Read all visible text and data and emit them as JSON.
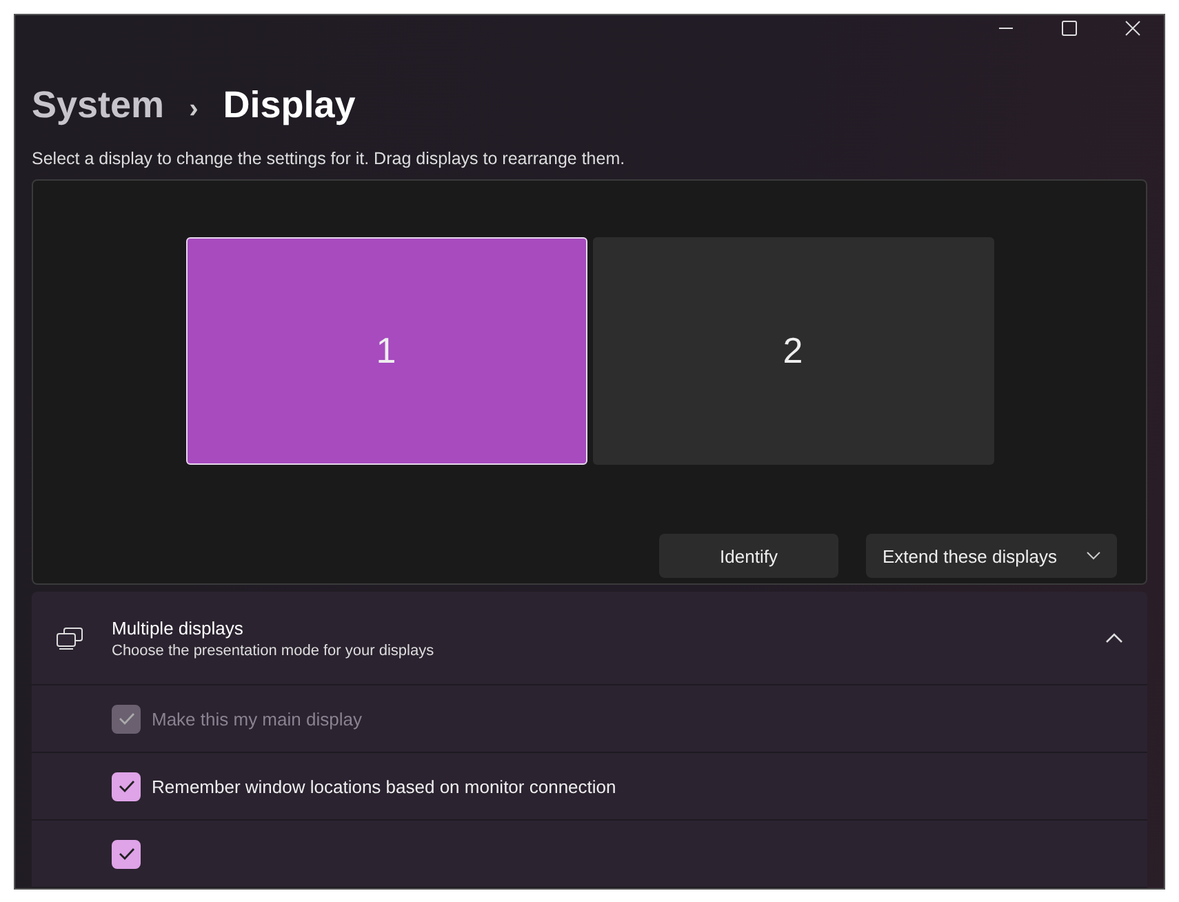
{
  "breadcrumb": {
    "parent": "System",
    "separator": "›",
    "current": "Display"
  },
  "description": "Select a display to change the settings for it. Drag displays to rearrange them.",
  "displays": [
    {
      "label": "1",
      "selected": true
    },
    {
      "label": "2",
      "selected": false
    }
  ],
  "buttons": {
    "identify": "Identify",
    "mode": "Extend these displays"
  },
  "section": {
    "title": "Multiple displays",
    "subtitle": "Choose the presentation mode for your displays",
    "expanded": true,
    "options": [
      {
        "label": "Make this my main display",
        "checked": true,
        "disabled": true
      },
      {
        "label": "Remember window locations based on monitor connection",
        "checked": true,
        "disabled": false
      },
      {
        "checked": true,
        "disabled": false
      }
    ]
  }
}
